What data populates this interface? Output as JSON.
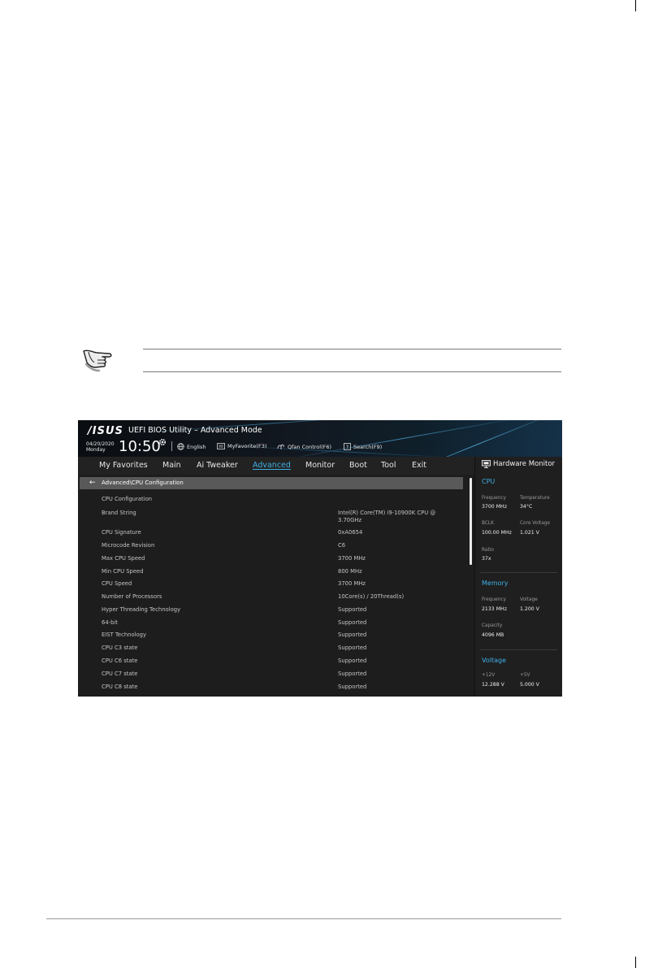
{
  "bios": {
    "logo": "/ISUS",
    "title": "UEFI BIOS Utility – Advanced Mode",
    "date": "04/20/2020",
    "day": "Monday",
    "time": "10:50",
    "utilities": [
      {
        "label": "English",
        "icon": "globe-icon"
      },
      {
        "label": "MyFavorite(F3)",
        "icon": "favorite-icon"
      },
      {
        "label": "Qfan Control(F6)",
        "icon": "fan-icon"
      },
      {
        "label": "Search(F9)",
        "icon": "search-help-icon"
      }
    ],
    "menu": [
      "My Favorites",
      "Main",
      "Ai Tweaker",
      "Advanced",
      "Monitor",
      "Boot",
      "Tool",
      "Exit"
    ],
    "active_menu": "Advanced",
    "breadcrumb": "Advanced\\CPU Configuration",
    "rows": [
      {
        "label": "CPU Configuration",
        "value": ""
      },
      {
        "label": "Brand String",
        "value": "Intel(R) Core(TM) i9-10900K CPU @ 3.70GHz"
      },
      {
        "label": "CPU Signature",
        "value": "0xA0654"
      },
      {
        "label": "Microcode Revision",
        "value": "C6"
      },
      {
        "label": "Max CPU Speed",
        "value": "3700 MHz"
      },
      {
        "label": "Min CPU Speed",
        "value": "800 MHz"
      },
      {
        "label": "CPU Speed",
        "value": "3700 MHz"
      },
      {
        "label": "Number of Processors",
        "value": "10Core(s) / 20Thread(s)"
      },
      {
        "label": "Hyper Threading Technology",
        "value": "Supported"
      },
      {
        "label": "64-bit",
        "value": "Supported"
      },
      {
        "label": "EIST Technology",
        "value": "Supported"
      },
      {
        "label": "CPU C3 state",
        "value": "Supported"
      },
      {
        "label": "CPU C6 state",
        "value": "Supported"
      },
      {
        "label": "CPU C7 state",
        "value": "Supported"
      },
      {
        "label": "CPU C8 state",
        "value": "Supported"
      }
    ],
    "hw": {
      "title": "Hardware Monitor",
      "cpu": {
        "heading": "CPU",
        "frequency_label": "Frequency",
        "frequency": "3700 MHz",
        "temperature_label": "Temperature",
        "temperature": "34°C",
        "bclk_label": "BCLK",
        "bclk": "100.00 MHz",
        "core_voltage_label": "Core Voltage",
        "core_voltage": "1.021 V",
        "ratio_label": "Ratio",
        "ratio": "37x"
      },
      "memory": {
        "heading": "Memory",
        "frequency_label": "Frequency",
        "frequency": "2133 MHz",
        "voltage_label": "Voltage",
        "voltage": "1.200 V",
        "capacity_label": "Capacity",
        "capacity": "4096 MB"
      },
      "voltage": {
        "heading": "Voltage",
        "v12_label": "+12V",
        "v12": "12.288 V",
        "v5_label": "+5V",
        "v5": "5.000 V"
      }
    }
  }
}
